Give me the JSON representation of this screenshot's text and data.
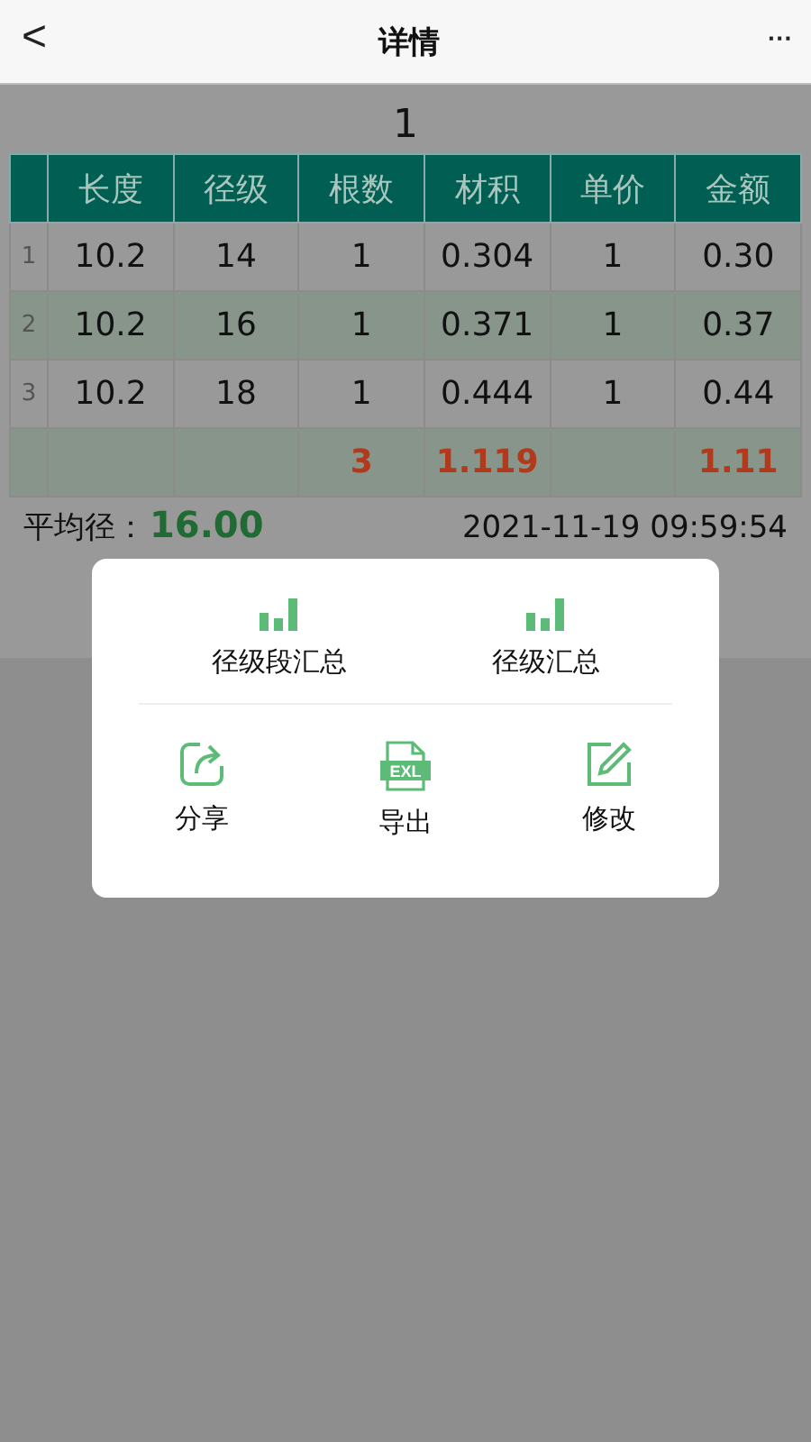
{
  "header": {
    "title": "详情",
    "back_glyph": "<",
    "more_glyph": "···"
  },
  "heading": "1",
  "table": {
    "columns": [
      "长度",
      "径级",
      "根数",
      "材积",
      "单价",
      "金额"
    ],
    "rows": [
      {
        "kind": "data",
        "index": "1",
        "cells": [
          "10.2",
          "14",
          "1",
          "0.304",
          "1",
          "0.30"
        ]
      },
      {
        "kind": "data",
        "index": "2",
        "cells": [
          "10.2",
          "16",
          "1",
          "0.371",
          "1",
          "0.37"
        ]
      },
      {
        "kind": "data",
        "index": "3",
        "cells": [
          "10.2",
          "18",
          "1",
          "0.444",
          "1",
          "0.44"
        ]
      },
      {
        "kind": "total",
        "index": "",
        "cells": [
          "",
          "",
          "3",
          "1.119",
          "",
          "1.11"
        ]
      }
    ]
  },
  "average": {
    "label": "平均径：",
    "value": "16.00"
  },
  "timestamp": "2021-11-19 09:59:54",
  "dialog": {
    "rows": [
      [
        {
          "kind": "chart",
          "label": "径级段汇总"
        },
        {
          "kind": "chart",
          "label": "径级汇总"
        }
      ],
      [
        {
          "kind": "share",
          "label": "分享"
        },
        {
          "kind": "export",
          "label": "导出",
          "badge": "EXL"
        },
        {
          "kind": "edit",
          "label": "修改"
        }
      ]
    ]
  }
}
